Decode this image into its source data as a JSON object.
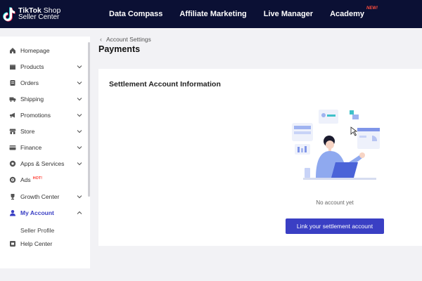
{
  "brand": {
    "name": "TikTok",
    "product": "Shop",
    "subtitle": "Seller Center"
  },
  "topnav": {
    "items": [
      {
        "label": "Data Compass"
      },
      {
        "label": "Affiliate Marketing"
      },
      {
        "label": "Live Manager"
      },
      {
        "label": "Academy",
        "badge": "NEW!"
      }
    ]
  },
  "sidebar": {
    "items": [
      {
        "label": "Homepage",
        "icon": "home-icon",
        "has_chevron": false
      },
      {
        "label": "Products",
        "icon": "box-icon",
        "has_chevron": true
      },
      {
        "label": "Orders",
        "icon": "orders-icon",
        "has_chevron": true
      },
      {
        "label": "Shipping",
        "icon": "truck-icon",
        "has_chevron": true
      },
      {
        "label": "Promotions",
        "icon": "megaphone-icon",
        "has_chevron": true
      },
      {
        "label": "Store",
        "icon": "store-icon",
        "has_chevron": true
      },
      {
        "label": "Finance",
        "icon": "card-icon",
        "has_chevron": true
      },
      {
        "label": "Apps & Services",
        "icon": "apps-icon",
        "has_chevron": true
      },
      {
        "label": "Ads",
        "icon": "ads-icon",
        "badge": "HOT!",
        "has_chevron": false
      },
      {
        "label": "Growth Center",
        "icon": "trophy-icon",
        "has_chevron": true
      },
      {
        "label": "My Account",
        "icon": "user-icon",
        "has_chevron": true,
        "expanded": true,
        "active": true
      },
      {
        "label": "Seller Profile",
        "sub": true
      },
      {
        "label": "Help Center",
        "icon": "help-icon",
        "has_chevron": false
      }
    ]
  },
  "breadcrumb": {
    "label": "Account Settings"
  },
  "page": {
    "title": "Payments"
  },
  "settlement": {
    "title": "Settlement Account Information",
    "empty_text": "No account yet",
    "button_label": "Link your settlement account"
  },
  "colors": {
    "topbar": "#0b1034",
    "accent": "#3a3fc4",
    "hot": "#ff3b30"
  }
}
